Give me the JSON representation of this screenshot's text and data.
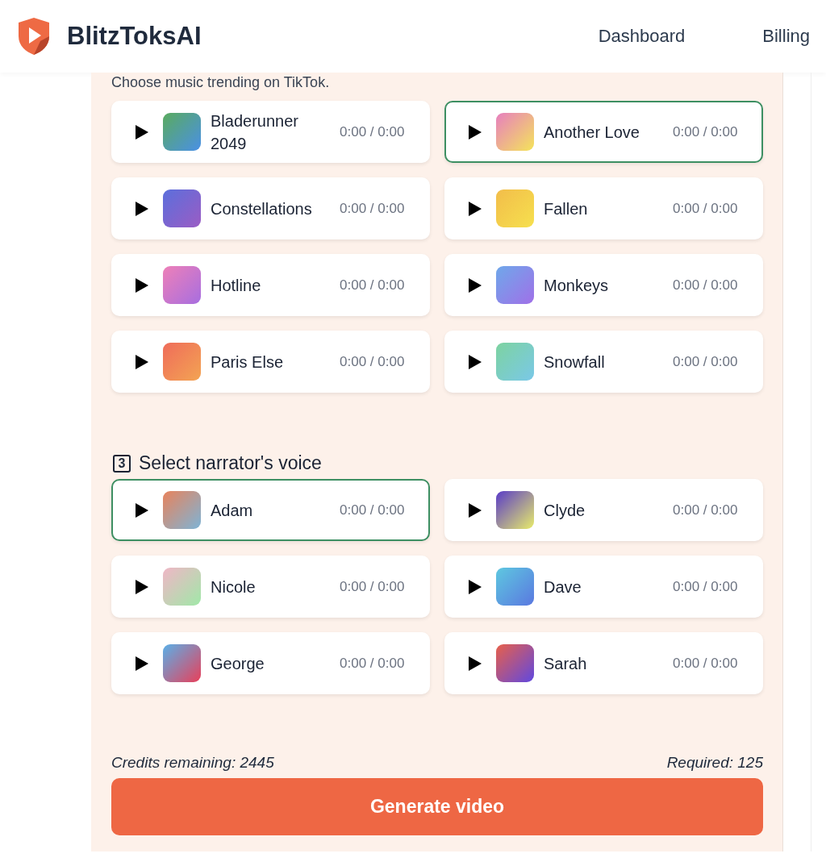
{
  "header": {
    "brand": "BlitzToksAI",
    "nav": [
      {
        "label": "Dashboard"
      },
      {
        "label": "Billing"
      }
    ]
  },
  "music": {
    "hint": "Choose music trending on TikTok.",
    "tracks": [
      {
        "name": "Bladerunner 2049",
        "time": "0:00 / 0:00",
        "selected": false
      },
      {
        "name": "Another Love",
        "time": "0:00 / 0:00",
        "selected": true
      },
      {
        "name": "Constellations",
        "time": "0:00 / 0:00",
        "selected": false
      },
      {
        "name": "Fallen",
        "time": "0:00 / 0:00",
        "selected": false
      },
      {
        "name": "Hotline",
        "time": "0:00 / 0:00",
        "selected": false
      },
      {
        "name": "Monkeys",
        "time": "0:00 / 0:00",
        "selected": false
      },
      {
        "name": "Paris Else",
        "time": "0:00 / 0:00",
        "selected": false
      },
      {
        "name": "Snowfall",
        "time": "0:00 / 0:00",
        "selected": false
      }
    ]
  },
  "voice": {
    "step": "3",
    "title": "Select narrator's voice",
    "voices": [
      {
        "name": "Adam",
        "time": "0:00 / 0:00",
        "selected": true
      },
      {
        "name": "Clyde",
        "time": "0:00 / 0:00",
        "selected": false
      },
      {
        "name": "Nicole",
        "time": "0:00 / 0:00",
        "selected": false
      },
      {
        "name": "Dave",
        "time": "0:00 / 0:00",
        "selected": false
      },
      {
        "name": "George",
        "time": "0:00 / 0:00",
        "selected": false
      },
      {
        "name": "Sarah",
        "time": "0:00 / 0:00",
        "selected": false
      }
    ]
  },
  "footer": {
    "credits": "Credits remaining: 2445",
    "required": "Required: 125",
    "button": "Generate video"
  }
}
